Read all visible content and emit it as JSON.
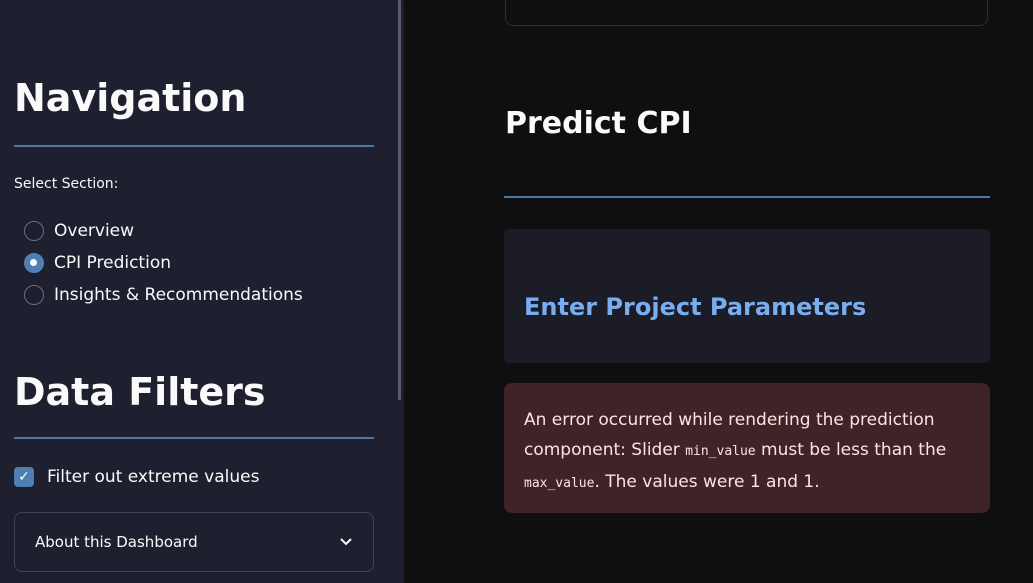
{
  "sidebar": {
    "nav_title": "Navigation",
    "select_label": "Select Section:",
    "options": [
      {
        "label": "Overview",
        "selected": false
      },
      {
        "label": "CPI Prediction",
        "selected": true
      },
      {
        "label": "Insights & Recommendations",
        "selected": false
      }
    ],
    "filters_title": "Data Filters",
    "filter_checkbox": {
      "label": "Filter out extreme values",
      "checked": true
    },
    "expander": {
      "label": "About this Dashboard",
      "icon": "chevron-down-icon"
    }
  },
  "main": {
    "title": "Predict CPI",
    "params_title": "Enter Project Parameters",
    "error": {
      "part1": "An error occurred while rendering the prediction component: Slider ",
      "code1": "min_value",
      "part2": " must be less than the ",
      "code2": "max_value",
      "part3": ". The values were 1 and 1."
    }
  },
  "colors": {
    "accent": "#4f7fb3",
    "link": "#78aef0",
    "error_bg": "#3f2326"
  }
}
